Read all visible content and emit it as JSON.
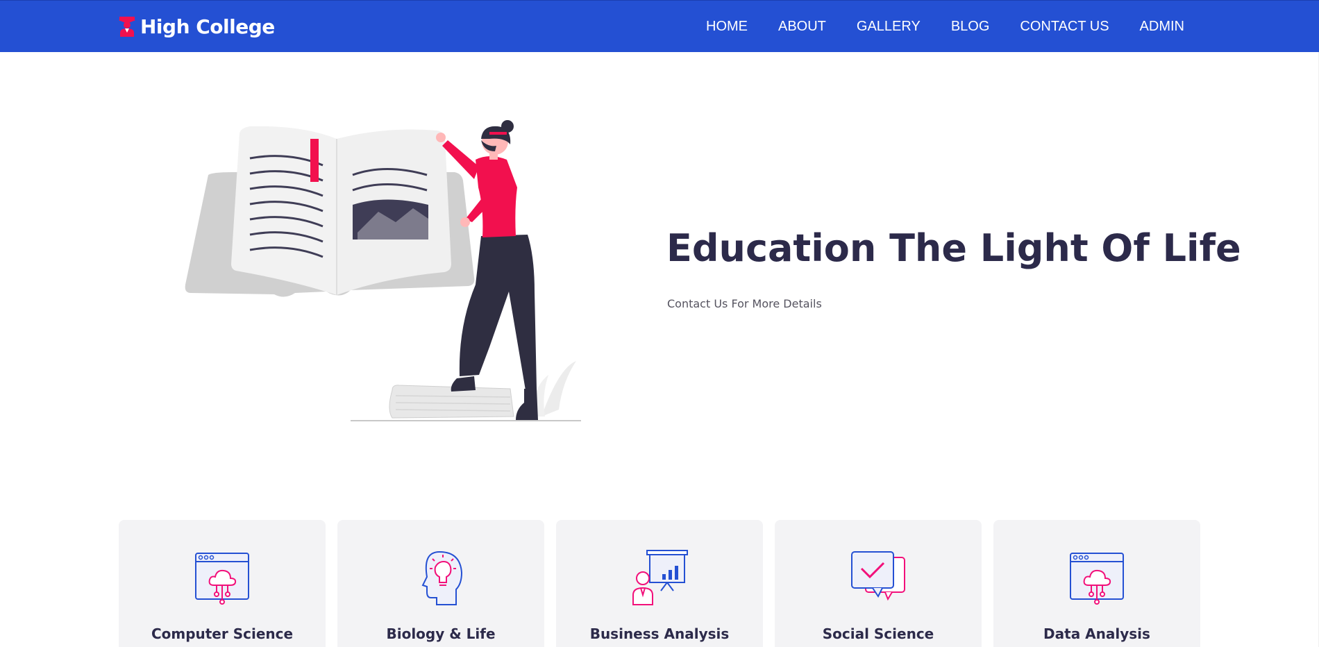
{
  "header": {
    "brand": "High College",
    "nav": [
      "HOME",
      "ABOUT",
      "GALLERY",
      "BLOG",
      "CONTACT US",
      "ADMIN"
    ]
  },
  "hero": {
    "title": "Education The Light Of Life",
    "subtitle": "Contact Us For More Details"
  },
  "cards": [
    {
      "title": "Computer Science",
      "icon": "cloud-computing-icon"
    },
    {
      "title": "Biology & Life",
      "icon": "head-lightbulb-icon"
    },
    {
      "title": "Business Analysis",
      "icon": "presentation-icon"
    },
    {
      "title": "Social Science",
      "icon": "chat-bubbles-icon"
    },
    {
      "title": "Data Analysis",
      "icon": "cloud-computing-icon"
    }
  ],
  "colors": {
    "navbar": "#2450d3",
    "accent": "#f2104e",
    "title": "#2c2a4a",
    "card_bg": "#f3f3f5",
    "icon_blue": "#2450d3",
    "icon_pink": "#f2107a"
  }
}
